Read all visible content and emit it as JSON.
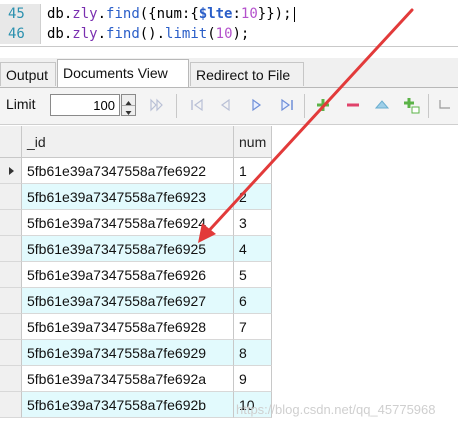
{
  "editor": {
    "lines": [
      {
        "number": "45",
        "db": "db",
        "coll": "zly",
        "fn": "find",
        "text_a": "({num:{",
        "op": "$lte",
        "text_b": ":",
        "num": "10",
        "text_c": "}});"
      },
      {
        "number": "46",
        "db": "db",
        "coll": "zly",
        "fn": "find",
        "text_a": "().",
        "fn2": "limit",
        "text_b": "(",
        "num": "10",
        "text_c": ");"
      }
    ]
  },
  "tabs": [
    {
      "label": "Output",
      "active": false
    },
    {
      "label": "Documents View",
      "active": true
    },
    {
      "label": "Redirect to File",
      "active": false
    }
  ],
  "toolbar": {
    "limit_label": "Limit",
    "limit_value": "100",
    "icons": [
      "first-page-icon",
      "first-icon",
      "prev-icon",
      "next-icon",
      "last-icon",
      "add-icon",
      "remove-icon",
      "up-icon",
      "add-field-icon"
    ]
  },
  "grid": {
    "columns": [
      "_id",
      "num"
    ],
    "rows": [
      {
        "_id": "5fb61e39a7347558a7fe6922",
        "num": "1"
      },
      {
        "_id": "5fb61e39a7347558a7fe6923",
        "num": "2"
      },
      {
        "_id": "5fb61e39a7347558a7fe6924",
        "num": "3"
      },
      {
        "_id": "5fb61e39a7347558a7fe6925",
        "num": "4"
      },
      {
        "_id": "5fb61e39a7347558a7fe6926",
        "num": "5"
      },
      {
        "_id": "5fb61e39a7347558a7fe6927",
        "num": "6"
      },
      {
        "_id": "5fb61e39a7347558a7fe6928",
        "num": "7"
      },
      {
        "_id": "5fb61e39a7347558a7fe6929",
        "num": "8"
      },
      {
        "_id": "5fb61e39a7347558a7fe692a",
        "num": "9"
      },
      {
        "_id": "5fb61e39a7347558a7fe692b",
        "num": "10"
      }
    ],
    "stripe_color": "#e2fafd"
  },
  "annotation": {
    "color": "#e23a3a"
  },
  "watermark": "https://blog.csdn.net/qq_45775968"
}
